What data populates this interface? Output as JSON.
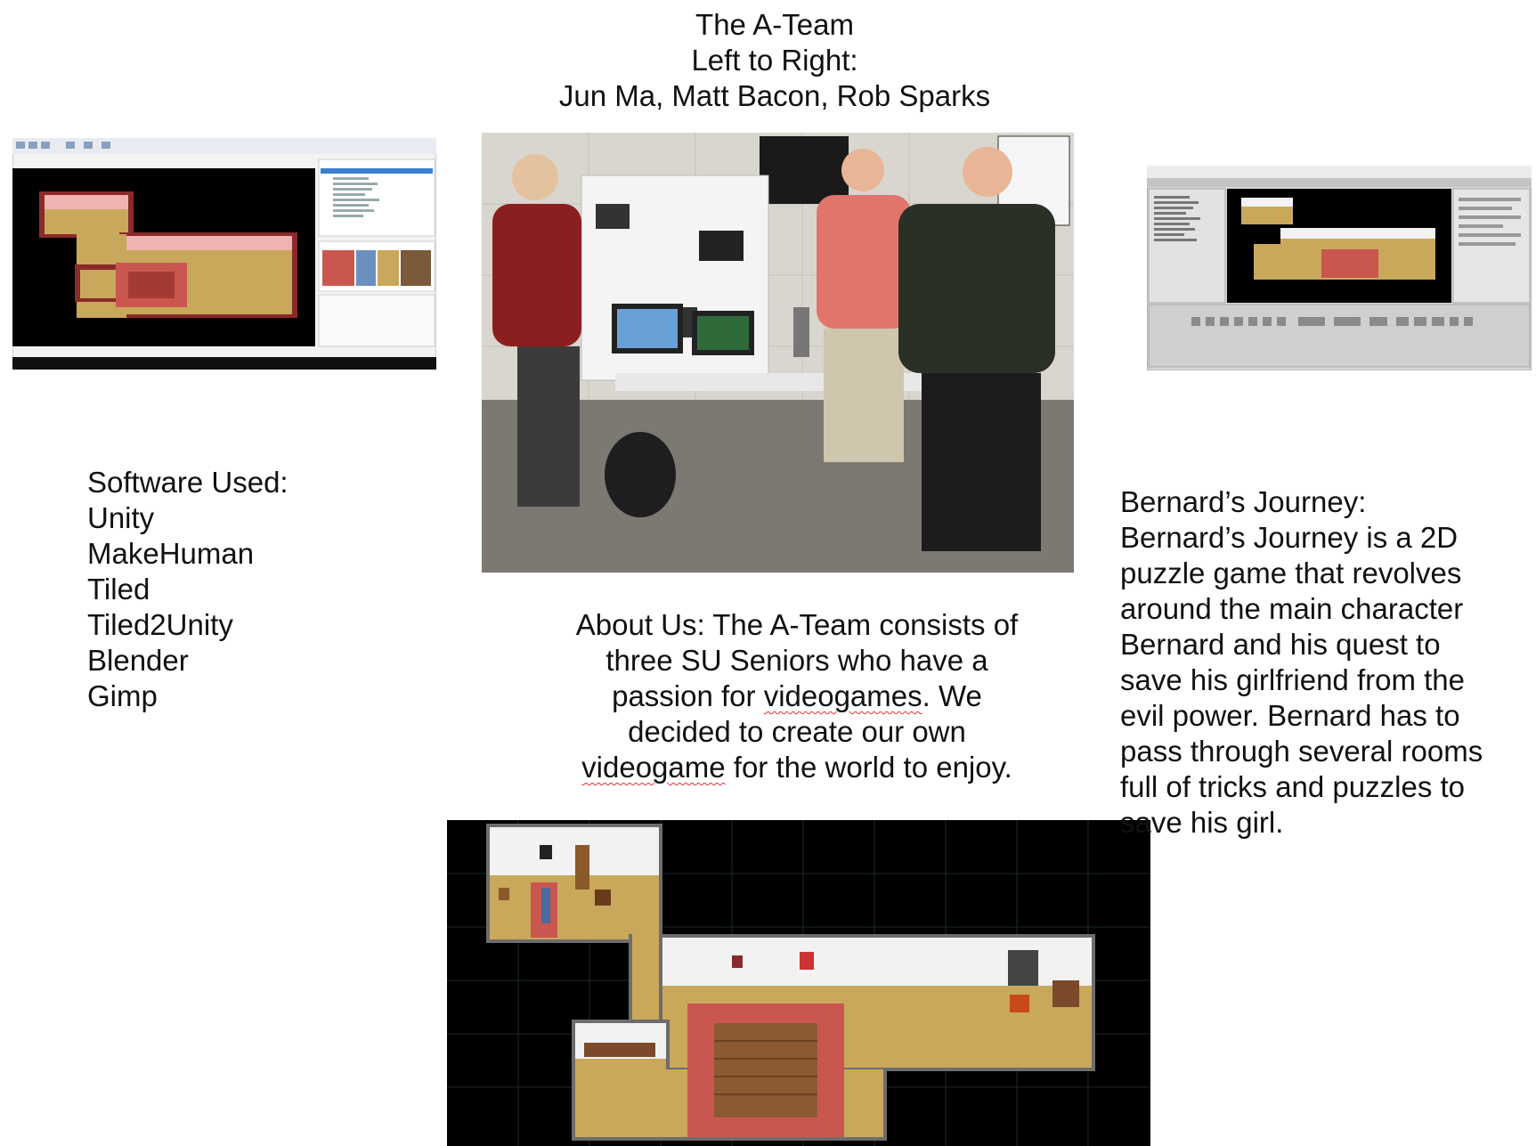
{
  "title": {
    "lines": [
      "The A-Team",
      "Left to Right:",
      "Jun Ma, Matt Bacon, Rob Sparks"
    ]
  },
  "software": {
    "heading": "Software Used:",
    "items": [
      "Unity",
      "MakeHuman",
      "Tiled",
      "Tiled2Unity",
      "Blender",
      "Gimp"
    ]
  },
  "about": {
    "line1": "About Us: The A-Team consists of",
    "line2": "three SU Seniors who have a",
    "line3a": "passion for ",
    "line3b": "videogames",
    "line3c": ". We",
    "line4": "decided to create our own",
    "line5a": "videogame",
    "line5b": " for the world to enjoy."
  },
  "game": {
    "lines": [
      "Bernard’s Journey:",
      "Bernard’s Journey is a 2D",
      "puzzle game that revolves",
      "around the main character",
      "Bernard and his quest to",
      "save his girlfriend from the",
      "evil power. Bernard has to",
      "pass through several rooms",
      "full of tricks and puzzles to",
      "save his girl."
    ]
  },
  "colors": {
    "floor": "#c9a85c",
    "wall": "#8b2a2a",
    "rug": "#c9574f",
    "backdrop": "#000000"
  }
}
